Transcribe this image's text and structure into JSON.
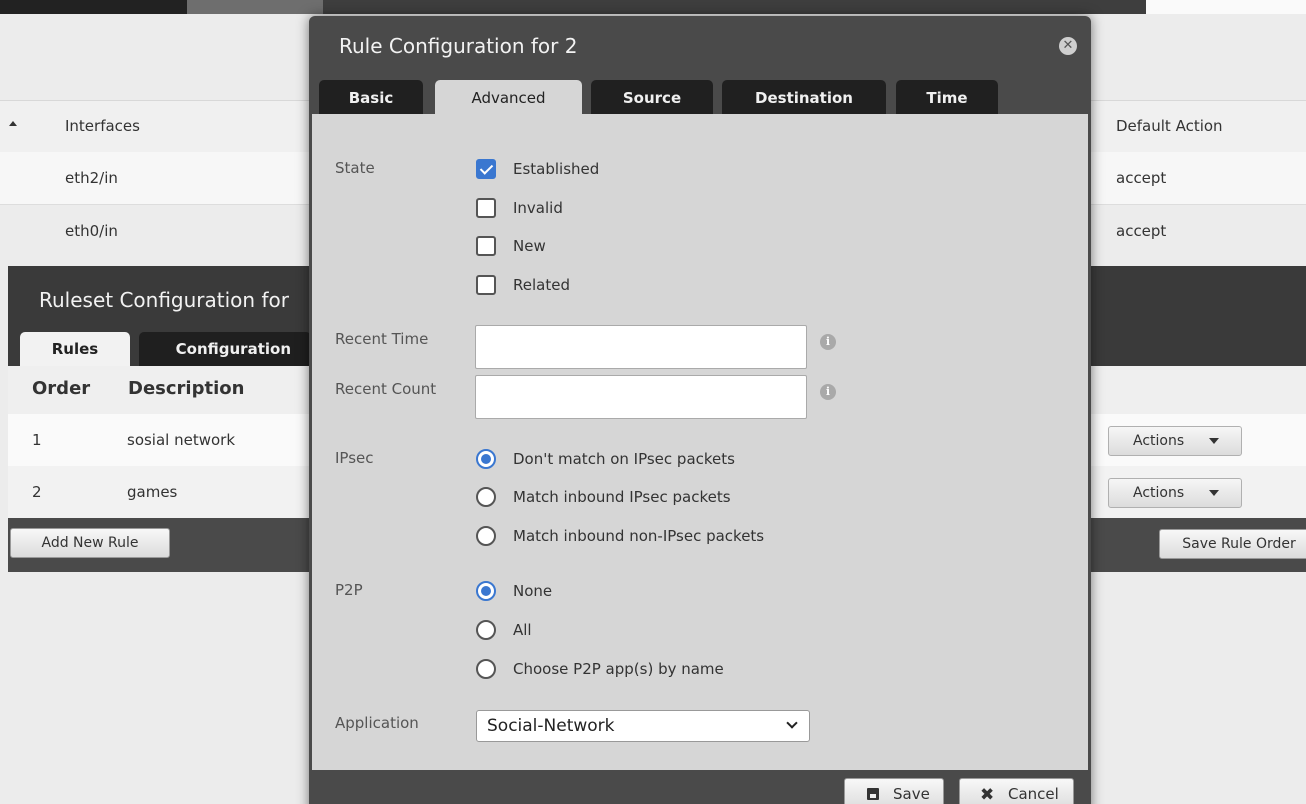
{
  "interfaces": {
    "headers": [
      "Interfaces",
      "Default Action"
    ],
    "rows": [
      {
        "interface": "eth2/in",
        "action": "accept"
      },
      {
        "interface": "eth0/in",
        "action": "accept"
      }
    ]
  },
  "ruleset": {
    "title": "Ruleset Configuration for",
    "tabs": [
      "Rules",
      "Configuration"
    ],
    "headers": {
      "order": "Order",
      "description": "Description"
    },
    "rows": [
      {
        "order": "1",
        "description": "sosial network",
        "actions": "Actions"
      },
      {
        "order": "2",
        "description": "games",
        "actions": "Actions"
      }
    ],
    "add_rule": "Add New Rule",
    "save_order": "Save Rule Order"
  },
  "modal": {
    "title": "Rule Configuration for 2",
    "close_glyph": "✕",
    "tabs": [
      "Basic",
      "Advanced",
      "Source",
      "Destination",
      "Time"
    ],
    "active_tab": "Advanced",
    "state": {
      "label": "State",
      "options": [
        {
          "label": "Established",
          "checked": true
        },
        {
          "label": "Invalid",
          "checked": false
        },
        {
          "label": "New",
          "checked": false
        },
        {
          "label": "Related",
          "checked": false
        }
      ]
    },
    "recent_time": {
      "label": "Recent Time",
      "value": "",
      "info": "i"
    },
    "recent_count": {
      "label": "Recent Count",
      "value": "",
      "info": "i"
    },
    "ipsec": {
      "label": "IPsec",
      "options": [
        {
          "label": "Don't match on IPsec packets",
          "checked": true
        },
        {
          "label": "Match inbound IPsec packets",
          "checked": false
        },
        {
          "label": "Match inbound non-IPsec packets",
          "checked": false
        }
      ]
    },
    "p2p": {
      "label": "P2P",
      "options": [
        {
          "label": "None",
          "checked": true
        },
        {
          "label": "All",
          "checked": false
        },
        {
          "label": "Choose P2P app(s) by name",
          "checked": false
        }
      ]
    },
    "application": {
      "label": "Application",
      "selected": "Social-Network"
    },
    "footer": {
      "save": "Save",
      "cancel": "Cancel"
    }
  },
  "colors": {
    "accent": "#3a77d0",
    "header_dark": "#4a4a4a",
    "tab_dark": "#202020",
    "panel": "#d6d6d6"
  }
}
